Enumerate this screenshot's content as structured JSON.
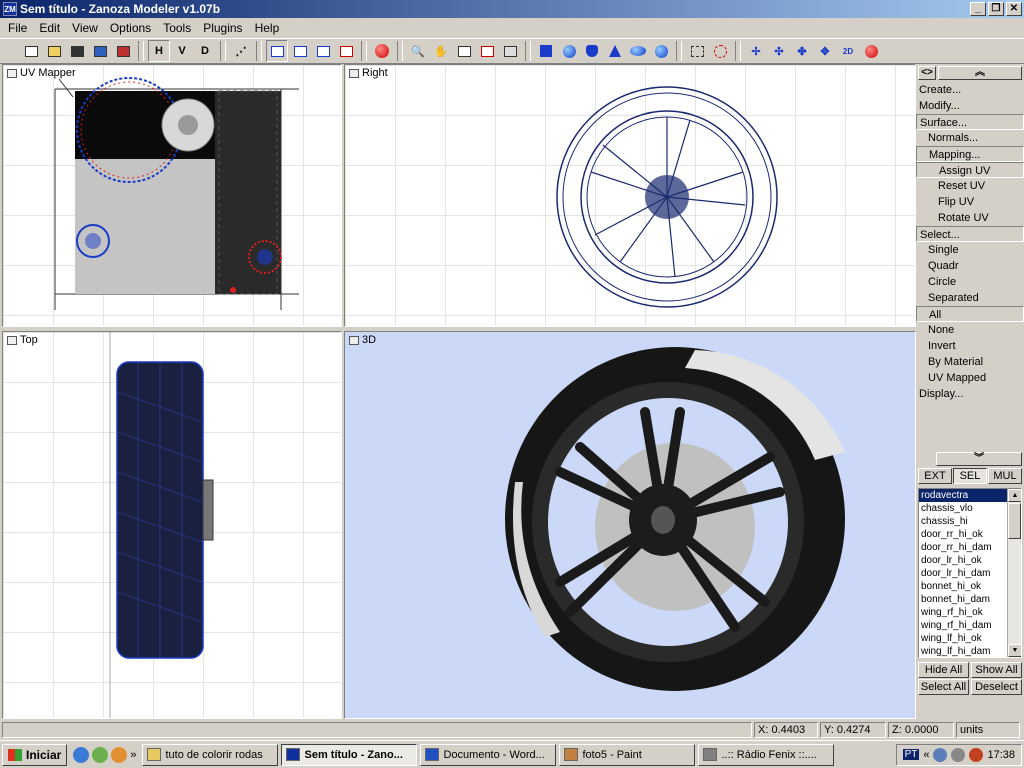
{
  "window": {
    "title": "Sem título - Zanoza Modeler v1.07b",
    "app_icon": "ZM",
    "minimize": "_",
    "maximize": "❐",
    "close": "✕"
  },
  "menu": [
    "File",
    "Edit",
    "View",
    "Options",
    "Tools",
    "Plugins",
    "Help"
  ],
  "toolbar": {
    "h_label": "H",
    "v_label": "V",
    "d_label": "D"
  },
  "viewports": {
    "uv_mapper": "UV Mapper",
    "right": "Right",
    "top": "Top",
    "view3d": "3D"
  },
  "panel": {
    "menu_items": [
      {
        "label": "Create...",
        "level": 0,
        "boxed": false
      },
      {
        "label": "Modify...",
        "level": 0,
        "boxed": false
      },
      {
        "label": "Surface...",
        "level": 0,
        "boxed": true
      },
      {
        "label": "Normals...",
        "level": 1,
        "boxed": false
      },
      {
        "label": "Mapping...",
        "level": 1,
        "boxed": true
      },
      {
        "label": "Assign UV",
        "level": 2,
        "boxed": true
      },
      {
        "label": "Reset UV",
        "level": 2,
        "boxed": false
      },
      {
        "label": "Flip UV",
        "level": 2,
        "boxed": false
      },
      {
        "label": "Rotate UV",
        "level": 2,
        "boxed": false
      },
      {
        "label": "Select...",
        "level": 0,
        "boxed": true
      },
      {
        "label": "Single",
        "level": 1,
        "boxed": false
      },
      {
        "label": "Quadr",
        "level": 1,
        "boxed": false
      },
      {
        "label": "Circle",
        "level": 1,
        "boxed": false
      },
      {
        "label": "Separated",
        "level": 1,
        "boxed": false
      },
      {
        "label": "All",
        "level": 1,
        "boxed": true
      },
      {
        "label": "None",
        "level": 1,
        "boxed": false
      },
      {
        "label": "Invert",
        "level": 1,
        "boxed": false
      },
      {
        "label": "By Material",
        "level": 1,
        "boxed": false
      },
      {
        "label": "UV Mapped",
        "level": 1,
        "boxed": false
      },
      {
        "label": "Display...",
        "level": 0,
        "boxed": false
      }
    ],
    "modes": [
      "EXT",
      "SEL",
      "MUL"
    ],
    "active_mode": "SEL",
    "objects": [
      "rodavectra",
      "chassis_vlo",
      "chassis_hi",
      "door_rr_hi_ok",
      "door_rr_hi_dam",
      "door_lr_hi_ok",
      "door_lr_hi_dam",
      "bonnet_hi_ok",
      "bonnet_hi_dam",
      "wing_rf_hi_ok",
      "wing_rf_hi_dam",
      "wing_lf_hi_ok",
      "wing_lf_hi_dam"
    ],
    "selected_object": "rodavectra",
    "hide_all": "Hide All",
    "show_all": "Show All",
    "select_all": "Select All",
    "deselect": "Deselect"
  },
  "status": {
    "x": "X: 0.4403",
    "y": "Y: 0.4274",
    "z": "Z: 0.0000",
    "units": "units"
  },
  "taskbar": {
    "start": "Iniciar",
    "tasks": [
      {
        "label": "tuto de colorir rodas",
        "active": false,
        "color": "#e8c860"
      },
      {
        "label": "Sem título - Zano...",
        "active": true,
        "color": "#1030a0"
      },
      {
        "label": "Documento - Word...",
        "active": false,
        "color": "#2050c0"
      },
      {
        "label": "foto5 - Paint",
        "active": false,
        "color": "#c08040"
      },
      {
        "label": "..:: Rádio Fenix ::....",
        "active": false,
        "color": "#808080"
      }
    ],
    "lang": "PT",
    "clock": "17:38"
  }
}
